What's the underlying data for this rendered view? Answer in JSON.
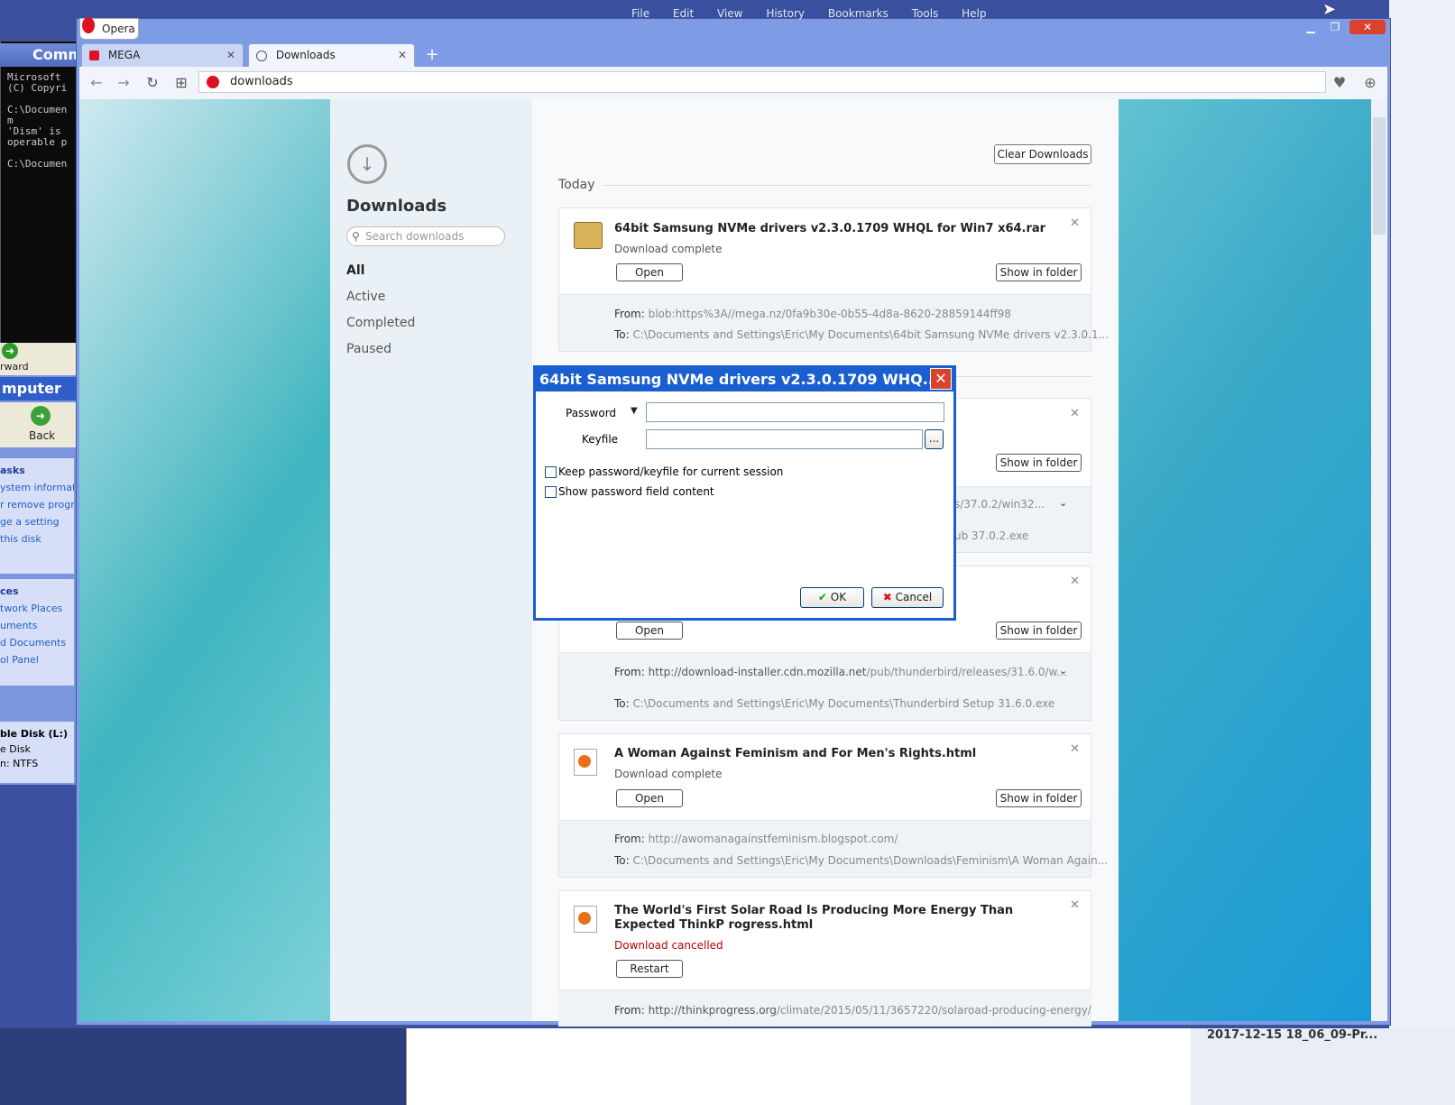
{
  "cmd": {
    "title": "Comm",
    "lines": "Microsoft\n(C) Copyri\n\nC:\\Documen\nm\n'Dism' is\noperable p\n\nC:\\Documen"
  },
  "explorer": {
    "toolbar_label": "rward",
    "title": "mputer",
    "back_label": "Back",
    "tasks_header": "asks",
    "tasks": [
      "ystem information",
      "r remove program",
      "ge a setting",
      "this disk"
    ],
    "places_header": "ces",
    "places": [
      "twork Places",
      "uments",
      "d Documents",
      "ol Panel"
    ],
    "disk_name": "ble Disk (L:)",
    "disk_type": "e Disk",
    "disk_fs": "n: NTFS"
  },
  "opera": {
    "menu_label": "Opera",
    "menubar": [
      "File",
      "Edit",
      "View",
      "History",
      "Bookmarks",
      "Tools",
      "Help"
    ],
    "tabs": [
      {
        "label": "MEGA"
      },
      {
        "label": "Downloads"
      }
    ],
    "url": "downloads"
  },
  "downloads": {
    "title": "Downloads",
    "search_placeholder": "Search downloads",
    "nav": [
      "All",
      "Active",
      "Completed",
      "Paused"
    ],
    "clear_button": "Clear Downloads",
    "section_today": "Today",
    "open_label": "Open",
    "show_label": "Show in folder",
    "restart_label": "Restart",
    "from_label": "From:",
    "to_label": "To:",
    "items": [
      {
        "name": "64bit Samsung NVMe drivers v2.3.0.1709 WHQL for Win7 x64.rar",
        "status": "Download complete",
        "from": "blob:https%3A//mega.nz/0fa9b30e-0b55-4d8a-8620-28859144ff98",
        "to": "C:\\Documents and Settings\\Eric\\My Documents\\64bit Samsung NVMe drivers v2.3.0.1..."
      },
      {
        "from_tail": "s/37.0.2/win32...",
        "to_tail": "ub 37.0.2.exe"
      },
      {
        "from_host": "http://download-installer.cdn.mozilla.net",
        "from_path": "/pub/thunderbird/releases/31.6.0/w...",
        "to": "C:\\Documents and Settings\\Eric\\My Documents\\Thunderbird Setup 31.6.0.exe"
      },
      {
        "name": "A Woman Against Feminism and For Men's Rights.html",
        "status": "Download complete",
        "from": "http://awomanagainstfeminism.blogspot.com/",
        "to": "C:\\Documents and Settings\\Eric\\My Documents\\Downloads\\Feminism\\A Woman Again..."
      },
      {
        "name": "The World's First Solar Road Is Producing More Energy Than Expected ThinkP rogress.html",
        "status": "Download cancelled",
        "from_host": "http://thinkprogress.org",
        "from_path": "/climate/2015/05/11/3657220/solaroad-producing-energy/"
      }
    ]
  },
  "dialog": {
    "title": "64bit Samsung NVMe drivers v2.3.0.1709 WHQ...",
    "password_label": "Password",
    "keyfile_label": "Keyfile",
    "browse_label": "...",
    "keep_label": "Keep password/keyfile for current session",
    "show_label": "Show password field content",
    "ok_label": "OK",
    "cancel_label": "Cancel"
  },
  "taskbar": {
    "right_item": "2017-12-15 18_06_09-Pr..."
  }
}
